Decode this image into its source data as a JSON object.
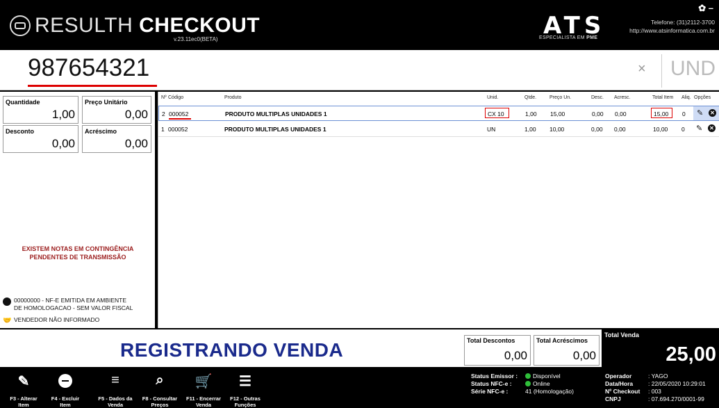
{
  "header": {
    "brand_light": "RESULTH ",
    "brand_bold": "CHECKOUT",
    "version": "v.23.11ec0(BETA)",
    "vendor_logo": "ATS",
    "vendor_tagline_a": "ESPECIALISTA EM ",
    "vendor_tagline_b": "PME",
    "phone": "Telefone: (31)2112-3700",
    "website": "http://www.atsinformatica.com.br",
    "settings_icon": "gear-icon",
    "minimize_label": "–"
  },
  "barcode": {
    "value": "987654321",
    "clear_label": "×",
    "unit": "UND"
  },
  "item_fields": {
    "quantidade_label": "Quantidade",
    "quantidade_value": "1,00",
    "preco_label": "Preço Unitário",
    "preco_value": "0,00",
    "desconto_label": "Desconto",
    "desconto_value": "0,00",
    "acrescimo_label": "Acréscimo",
    "acrescimo_value": "0,00"
  },
  "alert": {
    "line1": "EXISTEM NOTAS EM CONTINGÊNCIA",
    "line2": "PENDENTES DE TRANSMISSÃO"
  },
  "info": {
    "nfe_line1": "00000000 - NF-E EMITIDA EM AMBIENTE",
    "nfe_line2": "DE HOMOLOGACAO - SEM VALOR FISCAL",
    "vendor": "VENDEDOR NÃO INFORMADO"
  },
  "table": {
    "headers": {
      "num": "Nº",
      "code": "Código",
      "product": "Produto",
      "unit": "Unid.",
      "qty": "Qtde.",
      "price": "Preço Un.",
      "disc": "Desc.",
      "add": "Acresc.",
      "total": "Total Item",
      "aliq": "Aliq.",
      "options": "Opções"
    },
    "rows": [
      {
        "num": "2",
        "code": "000052",
        "product": "PRODUTO MULTIPLAS UNIDADES 1",
        "unit": "CX 10",
        "qty": "1,00",
        "price": "15,00",
        "disc": "0,00",
        "add": "0,00",
        "total": "15,00",
        "aliq": "0"
      },
      {
        "num": "1",
        "code": "000052",
        "product": "PRODUTO MULTIPLAS UNIDADES 1",
        "unit": "UN",
        "qty": "1,00",
        "price": "10,00",
        "disc": "0,00",
        "add": "0,00",
        "total": "10,00",
        "aliq": "0"
      }
    ],
    "edit_icon": "pencil-icon",
    "remove_icon": "remove-circle-icon",
    "remove_glyph": "✕"
  },
  "status": {
    "main": "REGISTRANDO VENDA",
    "total_descontos_label": "Total Descontos",
    "total_descontos_value": "0,00",
    "total_acrescimos_label": "Total Acréscimos",
    "total_acrescimos_value": "0,00",
    "total_venda_label": "Total Venda",
    "total_venda_value": "25,00"
  },
  "toolbar": {
    "buttons": [
      {
        "line1": "F3 - Alterar",
        "line2": "Item",
        "icon": "pencil-icon",
        "glyph": "✎"
      },
      {
        "line1": "F4 - Excluir",
        "line2": "Item",
        "icon": "minus-circle-icon"
      },
      {
        "line1": "F5 - Dados da",
        "line2": "Venda",
        "icon": "list-edit-icon",
        "glyph": "≡"
      },
      {
        "line1": "F8 - Consultar",
        "line2": "Preços",
        "icon": "search-icon",
        "glyph": "⌕"
      },
      {
        "line1": "F11 - Encerrar",
        "line2": "Venda",
        "icon": "cart-icon",
        "glyph": "🛒"
      },
      {
        "line1": "F12 - Outras",
        "line2": "Funções",
        "icon": "sliders-icon",
        "glyph": "☰"
      }
    ]
  },
  "system_status": {
    "emissor_label": "Status Emissor :",
    "emissor_value": "Disponível",
    "nfce_label": "Status NFC-e :",
    "nfce_value": "Online",
    "serie_label": "Série NFC-e :",
    "serie_value": "41 (Homologação)",
    "status_color": "#2fbf3a"
  },
  "operator": {
    "operador_label": "Operador",
    "operador_value": ": YAGO",
    "datahora_label": "Data/Hora",
    "datahora_value": ": 22/05/2020 10:29:01",
    "checkout_label": "Nº Checkout",
    "checkout_value": ": 003",
    "cnpj_label": "CNPJ",
    "cnpj_value": ": 07.694.270/0001-99"
  }
}
